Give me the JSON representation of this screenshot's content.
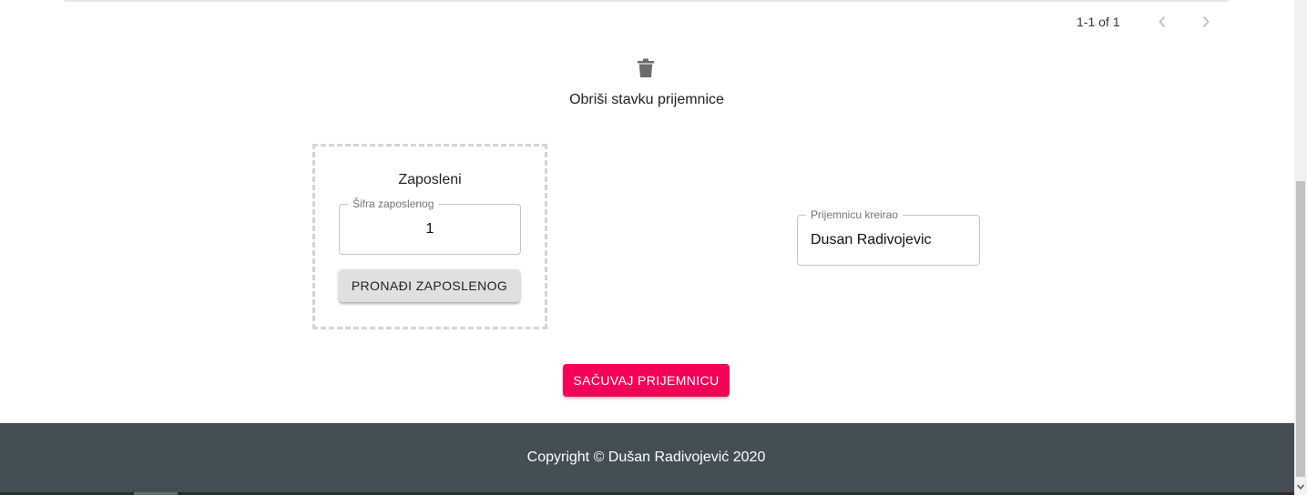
{
  "pagination": {
    "range_text": "1-1 of 1",
    "prev_icon": "chevron-left-icon",
    "next_icon": "chevron-right-icon"
  },
  "delete_item": {
    "icon": "trash-icon",
    "label": "Obriši stavku prijemnice"
  },
  "employee_section": {
    "title": "Zaposleni",
    "employee_id_field": {
      "label": "Šifra zaposlenog",
      "value": "1"
    },
    "find_button_label": "PRONAĐI ZAPOSLENOG"
  },
  "created_by_field": {
    "label": "Prijemnicu kreirao",
    "value": "Dusan Radivojevic"
  },
  "save_button_label": "SAČUVAJ PRIJEMNICU",
  "footer": {
    "copyright": "Copyright © Dušan Radivojević 2020"
  },
  "colors": {
    "accent": "#f50057",
    "footer_bg": "#434f55",
    "secondary_button": "#e0e0e0"
  }
}
